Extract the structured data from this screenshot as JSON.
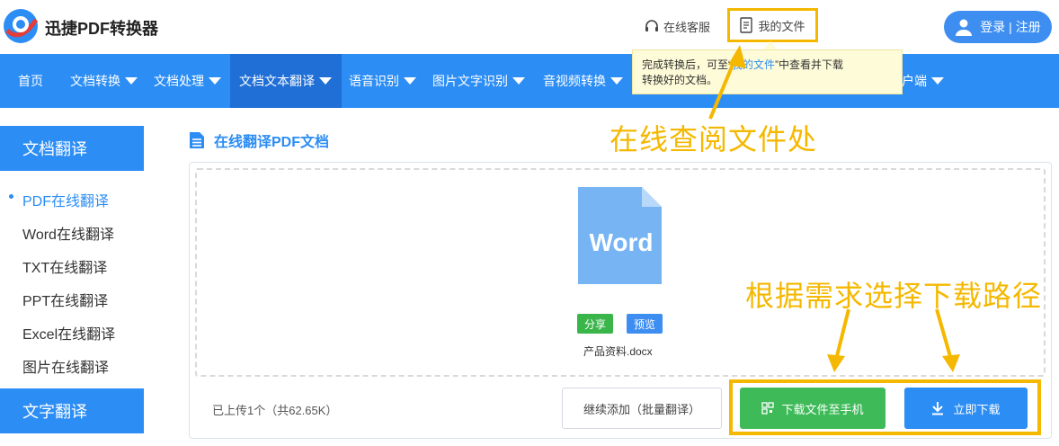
{
  "brand": {
    "name": "迅捷PDF转换器"
  },
  "header": {
    "service_label": "在线客服",
    "myfiles_label": "我的文件",
    "login_label": "登录",
    "register_label": "注册",
    "separator": "|"
  },
  "nav": {
    "items": [
      {
        "label": "首页",
        "has_caret": false
      },
      {
        "label": "文档转换",
        "has_caret": true
      },
      {
        "label": "文档处理",
        "has_caret": true
      },
      {
        "label": "文档文本翻译",
        "has_caret": true,
        "active": true
      },
      {
        "label": "语音识别",
        "has_caret": true
      },
      {
        "label": "图片文字识别",
        "has_caret": true
      },
      {
        "label": "音视频转换",
        "has_caret": true
      },
      {
        "label": "户端",
        "has_caret": true
      }
    ]
  },
  "tooltip": {
    "line1_a": "完成转换后，可至“",
    "line1_link": "我的文件",
    "line1_b": "”中查看并下载",
    "line2": "转换好的文档。"
  },
  "annotations": {
    "top": "在线查阅文件处",
    "bottom": "根据需求选择下载路径"
  },
  "sidebar": {
    "section1": "文档翻译",
    "items": [
      "PDF在线翻译",
      "Word在线翻译",
      "TXT在线翻译",
      "PPT在线翻译",
      "Excel在线翻译",
      "图片在线翻译"
    ],
    "section2": "文字翻译"
  },
  "main": {
    "title": "在线翻译PDF文档",
    "file_icon_text": "Word",
    "share_label": "分享",
    "preview_label": "预览",
    "filename": "产品资料.docx",
    "upload_info": "已上传1个（共62.65K）",
    "add_more_label": "继续添加（批量翻译）",
    "to_phone_label": "下载文件至手机",
    "download_label": "立即下载"
  },
  "colors": {
    "primary": "#2c8df4",
    "nav_active": "#1f6fd6",
    "highlight": "#f5b800",
    "green": "#3ebb58",
    "word_blue": "#6fb1f5"
  }
}
